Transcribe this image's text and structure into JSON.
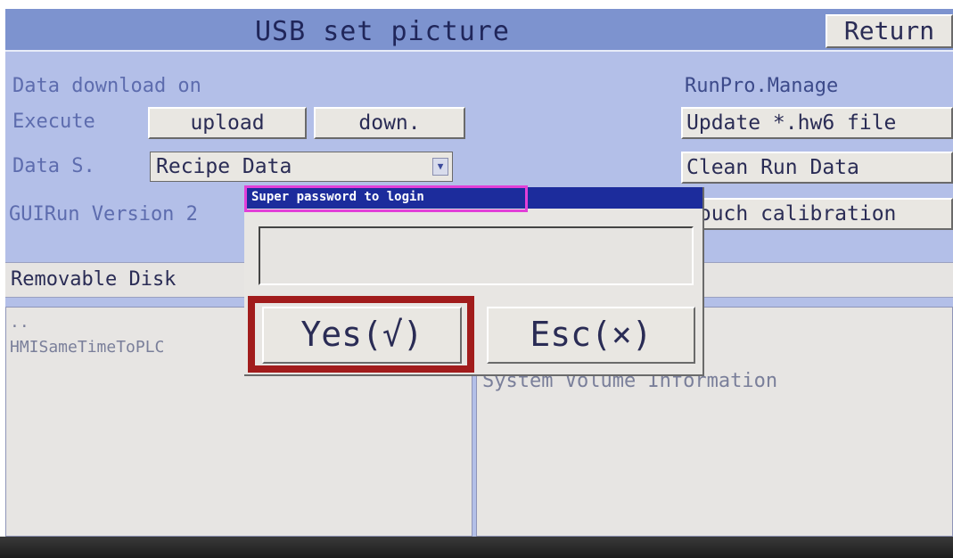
{
  "window": {
    "title": "USB set picture",
    "return_label": "Return"
  },
  "data_download": {
    "group_label": "Data download on",
    "execute_label": "Execute",
    "upload_label": "upload",
    "down_label": "down.",
    "source_label": "Data S.",
    "source_value": "Recipe Data",
    "version_text": "GUIRun Version 2"
  },
  "runpro": {
    "group_label": "RunPro.Manage",
    "update_label": "Update *.hw6 file",
    "clean_label": "Clean Run Data",
    "calibration_label": "Touch calibration"
  },
  "disk": {
    "label": "Removable Disk"
  },
  "files": {
    "left": [
      "..",
      "HMISameTimeToPLC"
    ],
    "right": [
      "System Volume Information"
    ]
  },
  "dialog": {
    "title": "Super password to login",
    "password_value": "",
    "yes_label": "Yes(√)",
    "esc_label": "Esc(×)"
  },
  "colors": {
    "screen_bg": "#b3bfe8",
    "titlebar_bg": "#7d93cf",
    "dialog_title_bg": "#1c2c9c",
    "highlight_magenta": "#e23fd8",
    "highlight_red": "#a11c1c"
  },
  "icons": {
    "combo_arrow": "chevron-down-icon"
  }
}
